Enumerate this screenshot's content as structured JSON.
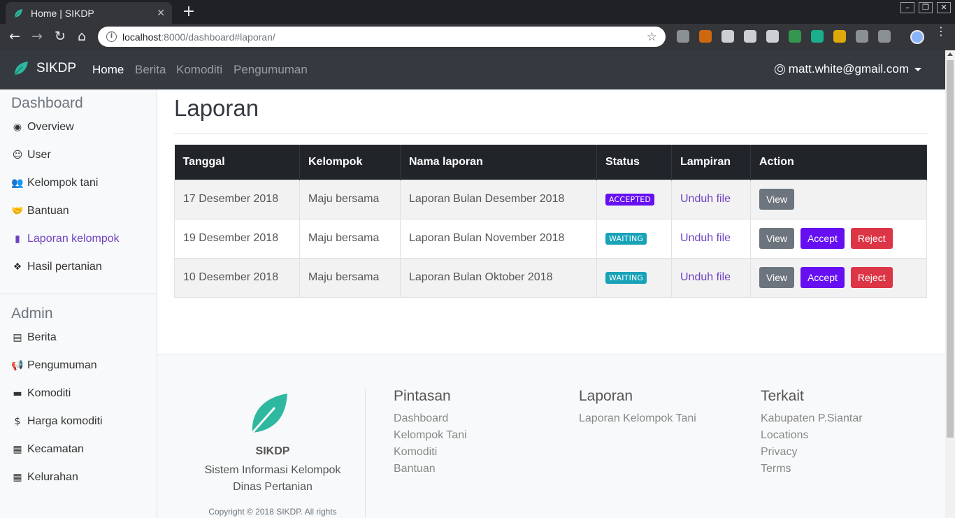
{
  "browser": {
    "tab_title": "Home | SIKDP",
    "tab_close": "✕",
    "new_tab": "+",
    "url_host": "localhost",
    "url_rest": ":8000/dashboard#laporan/",
    "icons": [
      "back-icon",
      "forward-icon",
      "reload-icon",
      "home-icon",
      "info-icon",
      "star-icon"
    ],
    "extension_colors": [
      "#9aa0a6",
      "#e8710a",
      "#e8eaed",
      "#e8eaed",
      "#e8eaed",
      "#34a853",
      "#15c39a",
      "#fbbc04",
      "#9aa0a6",
      "#9aa0a6"
    ],
    "window_controls": [
      "–",
      "❐",
      "✕"
    ]
  },
  "navbar": {
    "brand": "SIKDP",
    "links": [
      "Home",
      "Berita",
      "Komoditi",
      "Pengumuman"
    ],
    "active": "Home",
    "user": "matt.white@gmail.com"
  },
  "sidebar": {
    "dashboard_heading": "Dashboard",
    "dashboard_items": [
      {
        "label": "Overview",
        "icon": "dot-circle-icon"
      },
      {
        "label": "User",
        "icon": "user-circle-icon"
      },
      {
        "label": "Kelompok tani",
        "icon": "users-icon"
      },
      {
        "label": "Bantuan",
        "icon": "handshake-icon"
      },
      {
        "label": "Laporan kelompok",
        "icon": "file-icon",
        "active": true
      },
      {
        "label": "Hasil pertanian",
        "icon": "cubes-icon"
      }
    ],
    "admin_heading": "Admin",
    "admin_items": [
      {
        "label": "Berita",
        "icon": "newspaper-icon"
      },
      {
        "label": "Pengumuman",
        "icon": "bullhorn-icon"
      },
      {
        "label": "Komoditi",
        "icon": "briefcase-icon"
      },
      {
        "label": "Harga komoditi",
        "icon": "dollar-icon"
      },
      {
        "label": "Kecamatan",
        "icon": "building-icon"
      },
      {
        "label": "Kelurahan",
        "icon": "building-icon"
      }
    ]
  },
  "main": {
    "title": "Laporan",
    "table": {
      "headers": [
        "Tanggal",
        "Kelompok",
        "Nama laporan",
        "Status",
        "Lampiran",
        "Action"
      ],
      "rows": [
        {
          "tanggal": "17 Desember 2018",
          "kelompok": "Maju bersama",
          "nama": "Laporan Bulan Desember 2018",
          "status": "ACCEPTED",
          "lampiran": "Unduh file",
          "actions": [
            "View"
          ]
        },
        {
          "tanggal": "19 Desember 2018",
          "kelompok": "Maju bersama",
          "nama": "Laporan Bulan November 2018",
          "status": "WAITING",
          "lampiran": "Unduh file",
          "actions": [
            "View",
            "Accept",
            "Reject"
          ]
        },
        {
          "tanggal": "10 Desember 2018",
          "kelompok": "Maju bersama",
          "nama": "Laporan Bulan Oktober 2018",
          "status": "WAITING",
          "lampiran": "Unduh file",
          "actions": [
            "View",
            "Accept",
            "Reject"
          ]
        }
      ]
    }
  },
  "footer": {
    "brand": "SIKDP",
    "desc_line1": "Sistem Informasi Kelompok",
    "desc_line2": "Dinas Pertanian",
    "copyright": "Copyright © 2018 SIKDP. All rights",
    "columns": [
      {
        "heading": "Pintasan",
        "links": [
          "Dashboard",
          "Kelompok Tani",
          "Komoditi",
          "Bantuan"
        ]
      },
      {
        "heading": "Laporan",
        "links": [
          "Laporan Kelompok Tani"
        ]
      },
      {
        "heading": "Terkait",
        "links": [
          "Kabupaten P.Siantar",
          "Locations",
          "Privacy",
          "Terms"
        ]
      }
    ]
  },
  "colors": {
    "navbar_bg": "#343a40",
    "accent": "#6f42c1",
    "badge_accepted": "#6610f2",
    "badge_waiting": "#17a2b8",
    "btn_view": "#6c757d",
    "btn_accept": "#6610f2",
    "btn_reject": "#dc3545",
    "brand_leaf": "#2fb8a0"
  }
}
